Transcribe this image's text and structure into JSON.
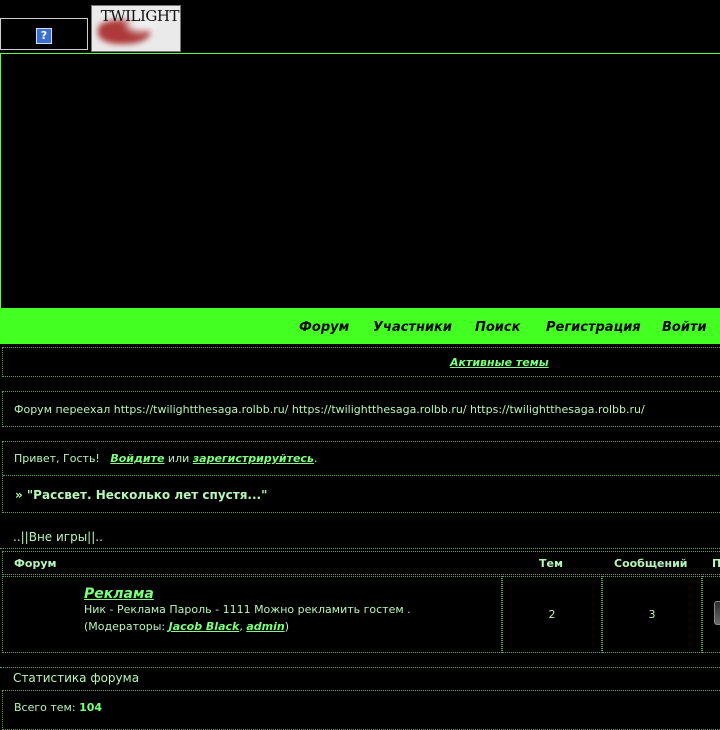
{
  "header": {
    "help_icon_glyph": "?",
    "logo_text": "TWILIGHT"
  },
  "nav": {
    "items": [
      "Форум",
      "Участники",
      "Поиск",
      "Регистрация",
      "Войти"
    ]
  },
  "active_topics": "Активные темы",
  "announcement": "Форум переехал https://twilightthesaga.rolbb.ru/ https://twilightthesaga.rolbb.ru/ https://twilightthesaga.rolbb.ru/",
  "greeting": {
    "prefix": "Привет, Гость!",
    "login": "Войдите",
    "or": "или",
    "register": "зарегистрируйтесь",
    "suffix": "."
  },
  "topic_banner": "» \"Рассвет. Несколько лет спустя...\"",
  "category": {
    "title": "..||Вне игры||..",
    "columns": [
      "Форум",
      "Тем",
      "Сообщений",
      "П"
    ],
    "forums": [
      {
        "name": "Реклама",
        "description": "Ник - Реклама Пароль - 1111 Можно рекламить гостем .",
        "moderators_prefix": "(Модераторы:",
        "moderators": [
          "Jacob Black",
          "admin"
        ],
        "moderators_sep": ",",
        "moderators_suffix": ")",
        "topics": "2",
        "posts": "3"
      }
    ]
  },
  "stats": {
    "title": "Статистика форума",
    "total_topics_label": "Всего тем:",
    "total_topics": "104"
  },
  "colors": {
    "accent": "#44ff22",
    "link": "#7dff7d",
    "text": "#b8f5b8",
    "background": "#000000"
  }
}
